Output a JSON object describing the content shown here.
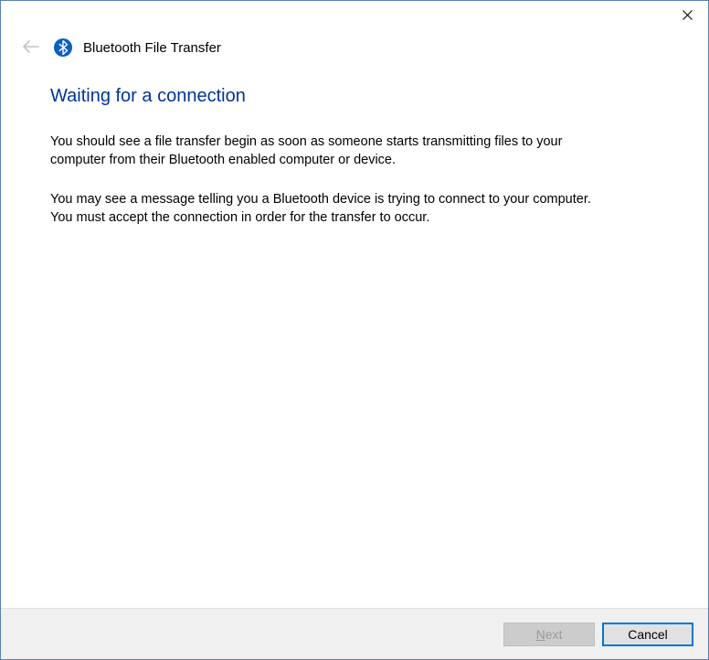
{
  "titlebar": {
    "close_label": "✕"
  },
  "header": {
    "title": "Bluetooth File Transfer"
  },
  "content": {
    "heading": "Waiting for a connection",
    "paragraph1": "You should see a file transfer begin as soon as someone starts transmitting files to your computer from their Bluetooth enabled computer or device.",
    "paragraph2": "You may see a message telling you a Bluetooth device is trying to connect to your computer. You must accept the connection in order for the transfer to occur."
  },
  "footer": {
    "next_prefix": "N",
    "next_suffix": "ext",
    "cancel_label": "Cancel"
  }
}
